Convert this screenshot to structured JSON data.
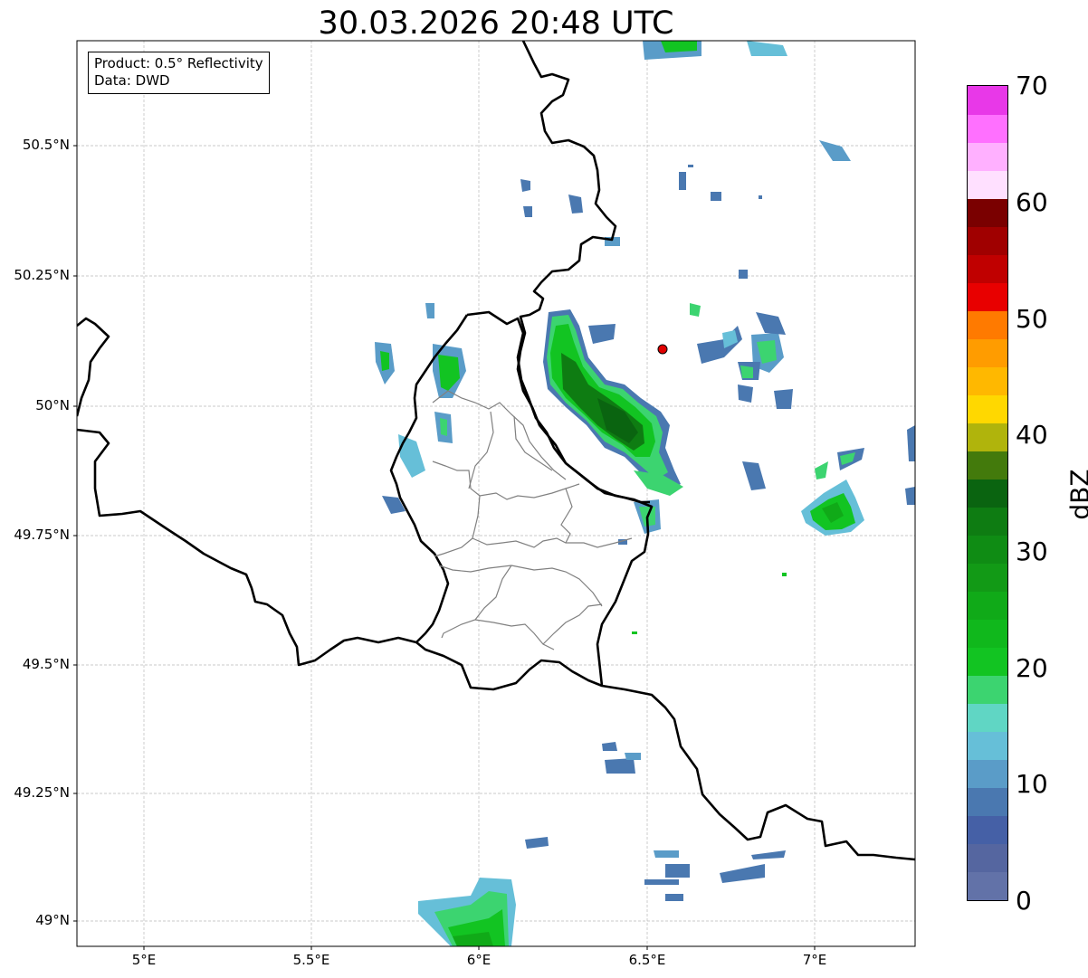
{
  "title": "30.03.2026 20:48 UTC",
  "info_box": {
    "product": "Product: 0.5° Reflectivity",
    "data": "Data: DWD"
  },
  "y_tick_labels": [
    "50.5°N",
    "50.25°N",
    "50°N",
    "49.75°N",
    "49.5°N",
    "49.25°N",
    "49°N"
  ],
  "x_tick_labels": [
    "5°E",
    "5.5°E",
    "6°E",
    "6.5°E",
    "7°E"
  ],
  "colorbar": {
    "unit": "dBZ",
    "range": [
      0,
      70
    ],
    "tick_labels": [
      "0",
      "10",
      "20",
      "30",
      "40",
      "50",
      "60",
      "70"
    ],
    "colors": [
      "#6272a8",
      "#5566a0",
      "#4560a6",
      "#4a78b0",
      "#5a9cc8",
      "#66bfd8",
      "#60d6c4",
      "#3cd470",
      "#12c422",
      "#10b81c",
      "#10aa18",
      "#129a16",
      "#0f8c14",
      "#0e7c12",
      "#0a6410",
      "#437a0c",
      "#b0b40c",
      "#ffd800",
      "#ffb800",
      "#ff9c00",
      "#ff7a00",
      "#e80000",
      "#c00000",
      "#a00000",
      "#7a0000",
      "#ffe0ff",
      "#ffb0ff",
      "#ff70ff",
      "#e838e8"
    ]
  },
  "marker": {
    "label": "radar-site",
    "color": "#e00000"
  },
  "map_colors": {
    "border": "#000000",
    "admin": "#808080",
    "grid": "#b0b0b0"
  }
}
